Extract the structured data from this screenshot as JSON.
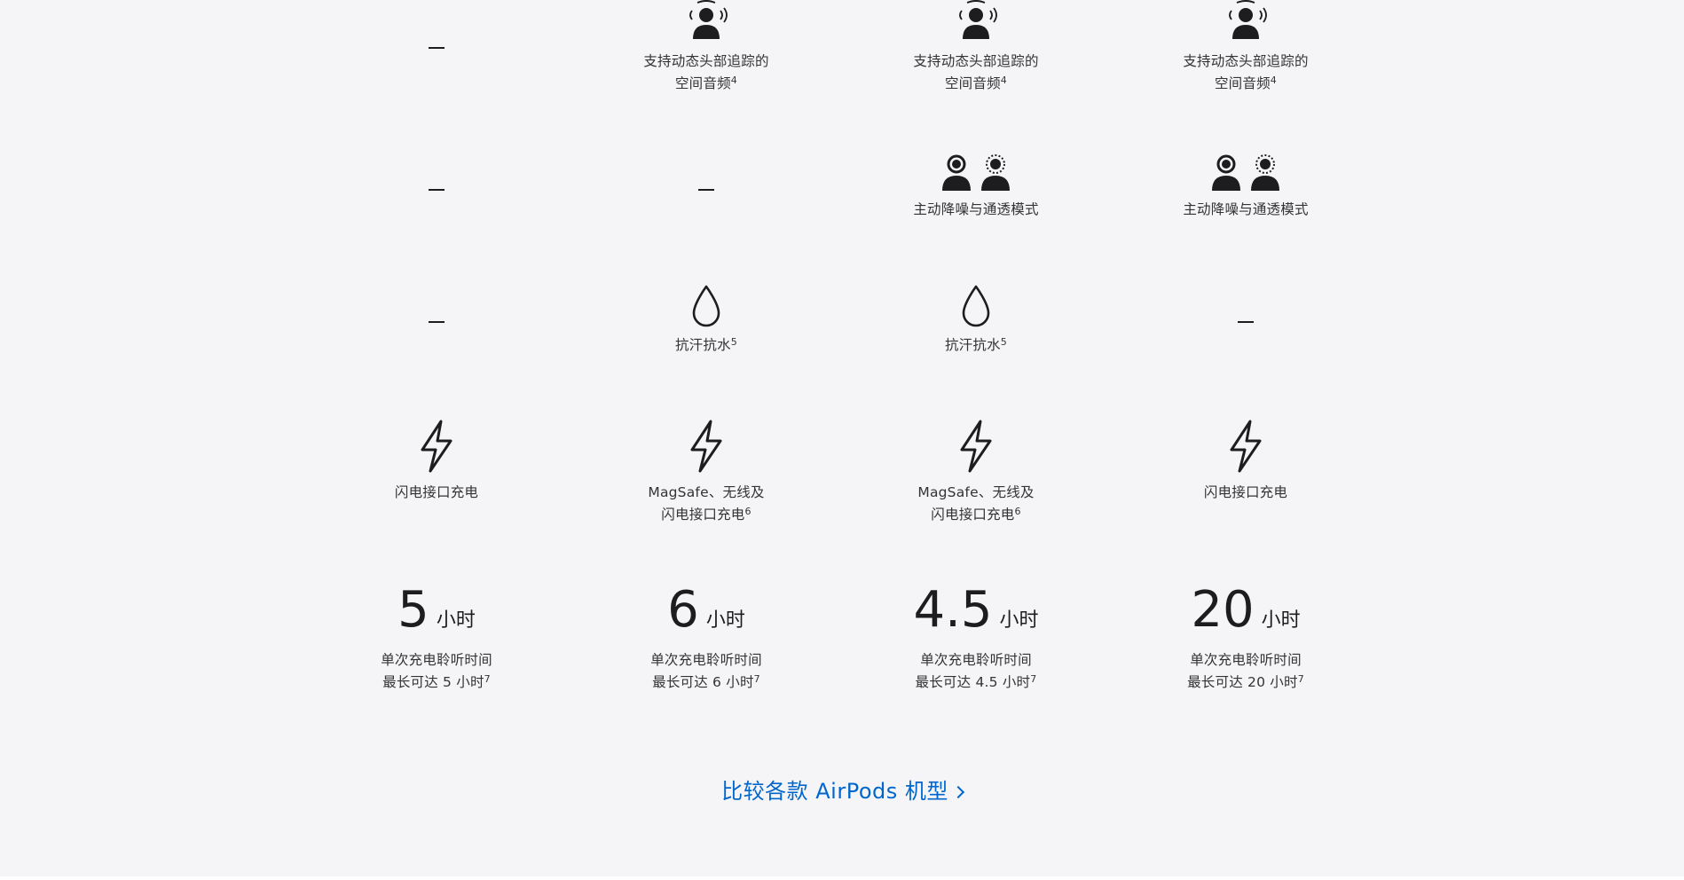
{
  "columns": [
    {
      "spatial_audio": null,
      "anc": null,
      "water": null,
      "charging": {
        "caption_line1": "闪电接口充电",
        "caption_line2": "",
        "footnote": ""
      },
      "battery": {
        "hours": "5",
        "unit": "小时",
        "line1": "单次充电聆听时间",
        "line2": "最长可达 5 小时",
        "footnote": "7"
      }
    },
    {
      "spatial_audio": {
        "line1": "支持动态头部追踪的",
        "line2": "空间音频",
        "footnote": "4"
      },
      "anc": null,
      "water": {
        "caption": "抗汗抗水",
        "footnote": "5"
      },
      "charging": {
        "caption_line1": "MagSafe、无线及",
        "caption_line2": "闪电接口充电",
        "footnote": "6"
      },
      "battery": {
        "hours": "6",
        "unit": "小时",
        "line1": "单次充电聆听时间",
        "line2": "最长可达 6 小时",
        "footnote": "7"
      }
    },
    {
      "spatial_audio": {
        "line1": "支持动态头部追踪的",
        "line2": "空间音频",
        "footnote": "4"
      },
      "anc": {
        "caption": "主动降噪与通透模式"
      },
      "water": {
        "caption": "抗汗抗水",
        "footnote": "5"
      },
      "charging": {
        "caption_line1": "MagSafe、无线及",
        "caption_line2": "闪电接口充电",
        "footnote": "6"
      },
      "battery": {
        "hours": "4.5",
        "unit": "小时",
        "line1": "单次充电聆听时间",
        "line2": "最长可达 4.5 小时",
        "footnote": "7"
      }
    },
    {
      "spatial_audio": {
        "line1": "支持动态头部追踪的",
        "line2": "空间音频",
        "footnote": "4"
      },
      "anc": {
        "caption": "主动降噪与通透模式"
      },
      "water": null,
      "charging": {
        "caption_line1": "闪电接口充电",
        "caption_line2": "",
        "footnote": ""
      },
      "battery": {
        "hours": "20",
        "unit": "小时",
        "line1": "单次充电聆听时间",
        "line2": "最长可达 20 小时",
        "footnote": "7"
      }
    }
  ],
  "icons": {
    "spatial_audio": "spatial-audio-head-icon",
    "anc": "anc-transparency-icon",
    "water": "water-drop-icon",
    "charging": "lightning-bolt-icon"
  },
  "compare_link": {
    "label": "比较各款 AirPods 机型"
  },
  "colors": {
    "background": "#f5f5f7",
    "link": "#0066cc",
    "text": "#1d1d1f"
  }
}
